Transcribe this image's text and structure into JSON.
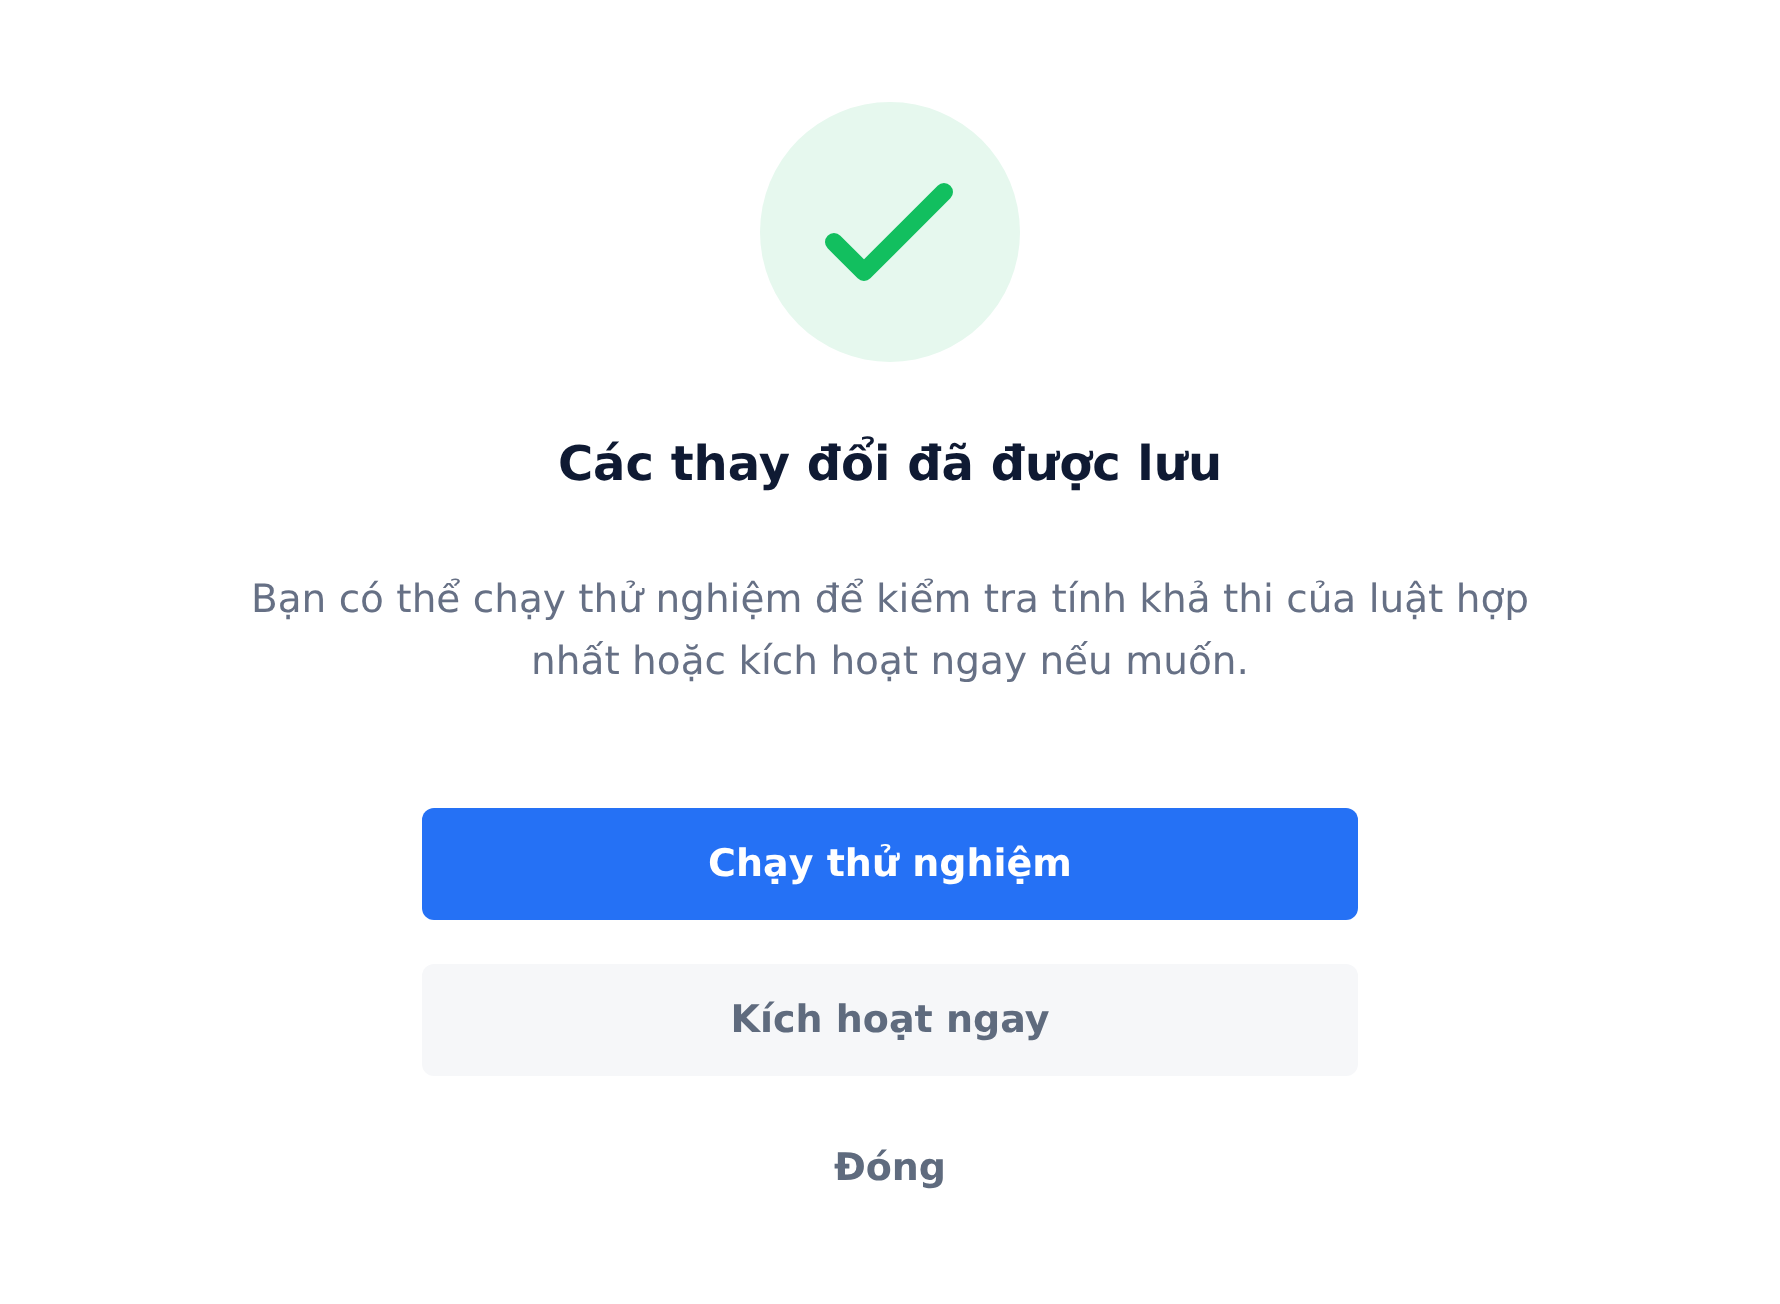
{
  "title": "Các thay đổi đã được lưu",
  "message": "Bạn có thể chạy thử nghiệm để kiểm tra tính khả thi của luật hợp nhất hoặc kích hoạt ngay nếu muốn.",
  "buttons": [
    {
      "label": "Chạy thử nghiệm",
      "kind": "primary"
    },
    {
      "label": "Kích hoạt ngay",
      "kind": "secondary"
    },
    {
      "label": "Đóng",
      "kind": "link"
    }
  ]
}
